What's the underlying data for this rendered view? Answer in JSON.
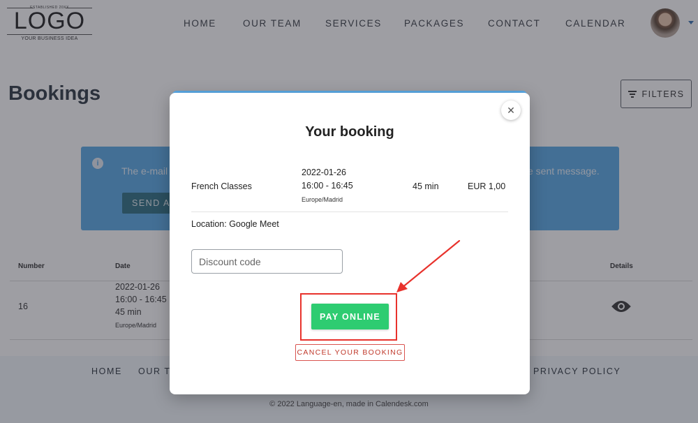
{
  "header": {
    "logo": {
      "established": "ESTABLISHED 20XX",
      "wordmark": "LOGO",
      "tagline": "YOUR BUSINESS IDEA"
    },
    "nav": [
      "HOME",
      "OUR TEAM",
      "SERVICES",
      "PACKAGES",
      "CONTACT",
      "CALENDAR"
    ],
    "avatar_icon": "user-avatar",
    "avatar_menu_icon": "caret-down-icon"
  },
  "page": {
    "title": "Bookings",
    "filters_label": "FILTERS",
    "filters_icon": "filter-icon"
  },
  "info_alert": {
    "icon": "info-icon",
    "text_left": "The e-mail",
    "text_right": "e sent message.",
    "button_label": "SEND AG"
  },
  "table": {
    "headers": {
      "number": "Number",
      "date": "Date",
      "details": "Details"
    },
    "rows": [
      {
        "number": "16",
        "date": "2022-01-26",
        "time": "16:00 - 16:45",
        "duration": "45 min",
        "timezone": "Europe/Madrid",
        "details_icon": "eye-icon"
      }
    ]
  },
  "footer": {
    "links": [
      "HOME",
      "OUR TE",
      "PRIVACY POLICY"
    ],
    "copyright": "© 2022 Language-en, made in Calendesk.com"
  },
  "modal": {
    "title": "Your booking",
    "close_icon": "close-icon",
    "booking": {
      "service": "French Classes",
      "date": "2022-01-26",
      "time": "16:00 - 16:45",
      "timezone": "Europe/Madrid",
      "duration": "45 min",
      "price": "EUR 1,00"
    },
    "location": "Location: Google Meet",
    "discount": {
      "placeholder": "Discount code",
      "value": ""
    },
    "pay_label": "PAY ONLINE",
    "cancel_label": "CANCEL YOUR BOOKING"
  },
  "colors": {
    "accent_blue": "#5aa9e6",
    "pay_green": "#2ecc71",
    "cancel_red": "#d9534f",
    "annotation_red": "#e8322c"
  }
}
